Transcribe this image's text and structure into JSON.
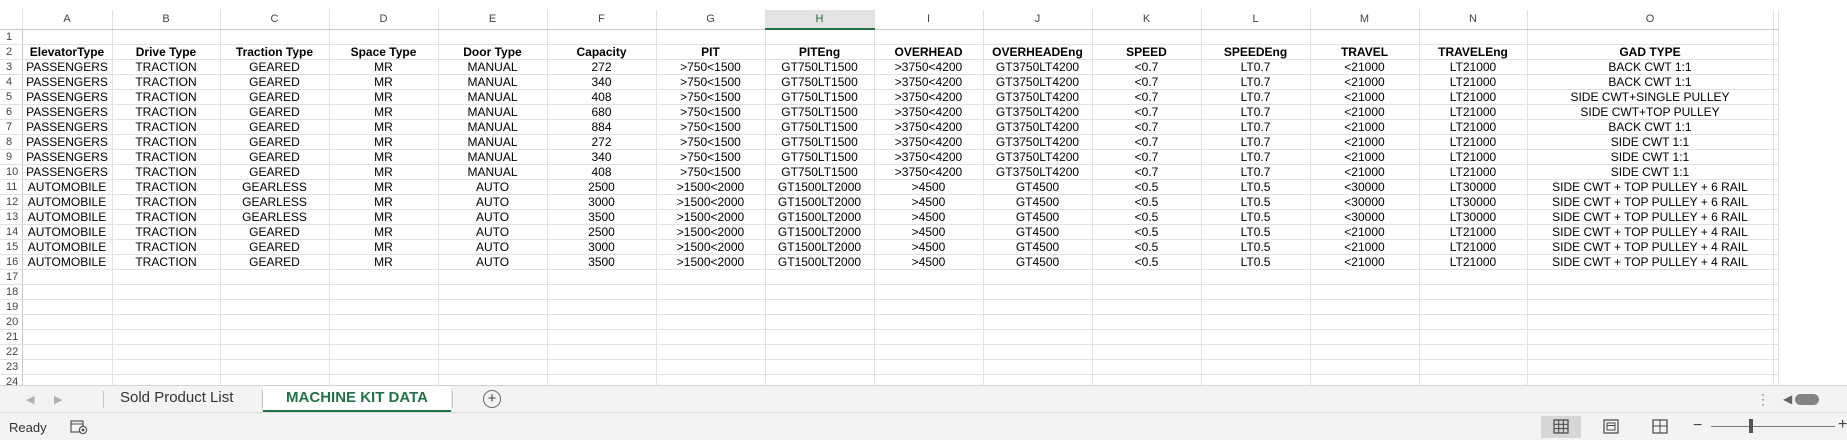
{
  "sheet": {
    "columns": [
      "A",
      "B",
      "C",
      "D",
      "E",
      "F",
      "G",
      "H",
      "I",
      "J",
      "K",
      "L",
      "M",
      "N",
      "O"
    ],
    "selected_column": "H",
    "visible_rows": [
      1,
      2,
      3,
      4,
      5,
      6,
      7,
      8,
      9,
      10,
      11,
      12,
      13,
      14,
      15,
      16,
      17,
      18,
      19,
      20,
      21,
      22,
      23,
      24
    ],
    "header_row_number": 2,
    "headers": [
      "ElevatorType",
      "Drive Type",
      "Traction Type",
      "Space Type",
      "Door Type",
      "Capacity",
      "PIT",
      "PITEng",
      "OVERHEAD",
      "OVERHEADEng",
      "SPEED",
      "SPEEDEng",
      "TRAVEL",
      "TRAVELEng",
      "GAD TYPE"
    ],
    "data_start_row": 3,
    "rows": [
      [
        "PASSENGERS",
        "TRACTION",
        "GEARED",
        "MR",
        "MANUAL",
        "272",
        ">750<1500",
        "GT750LT1500",
        ">3750<4200",
        "GT3750LT4200",
        "<0.7",
        "LT0.7",
        "<21000",
        "LT21000",
        "BACK CWT 1:1"
      ],
      [
        "PASSENGERS",
        "TRACTION",
        "GEARED",
        "MR",
        "MANUAL",
        "340",
        ">750<1500",
        "GT750LT1500",
        ">3750<4200",
        "GT3750LT4200",
        "<0.7",
        "LT0.7",
        "<21000",
        "LT21000",
        "BACK CWT 1:1"
      ],
      [
        "PASSENGERS",
        "TRACTION",
        "GEARED",
        "MR",
        "MANUAL",
        "408",
        ">750<1500",
        "GT750LT1500",
        ">3750<4200",
        "GT3750LT4200",
        "<0.7",
        "LT0.7",
        "<21000",
        "LT21000",
        "SIDE CWT+SINGLE PULLEY"
      ],
      [
        "PASSENGERS",
        "TRACTION",
        "GEARED",
        "MR",
        "MANUAL",
        "680",
        ">750<1500",
        "GT750LT1500",
        ">3750<4200",
        "GT3750LT4200",
        "<0.7",
        "LT0.7",
        "<21000",
        "LT21000",
        "SIDE CWT+TOP PULLEY"
      ],
      [
        "PASSENGERS",
        "TRACTION",
        "GEARED",
        "MR",
        "MANUAL",
        "884",
        ">750<1500",
        "GT750LT1500",
        ">3750<4200",
        "GT3750LT4200",
        "<0.7",
        "LT0.7",
        "<21000",
        "LT21000",
        "BACK CWT 1:1"
      ],
      [
        "PASSENGERS",
        "TRACTION",
        "GEARED",
        "MR",
        "MANUAL",
        "272",
        ">750<1500",
        "GT750LT1500",
        ">3750<4200",
        "GT3750LT4200",
        "<0.7",
        "LT0.7",
        "<21000",
        "LT21000",
        "SIDE CWT 1:1"
      ],
      [
        "PASSENGERS",
        "TRACTION",
        "GEARED",
        "MR",
        "MANUAL",
        "340",
        ">750<1500",
        "GT750LT1500",
        ">3750<4200",
        "GT3750LT4200",
        "<0.7",
        "LT0.7",
        "<21000",
        "LT21000",
        "SIDE CWT 1:1"
      ],
      [
        "PASSENGERS",
        "TRACTION",
        "GEARED",
        "MR",
        "MANUAL",
        "408",
        ">750<1500",
        "GT750LT1500",
        ">3750<4200",
        "GT3750LT4200",
        "<0.7",
        "LT0.7",
        "<21000",
        "LT21000",
        "SIDE CWT 1:1"
      ],
      [
        "AUTOMOBILE",
        "TRACTION",
        "GEARLESS",
        "MR",
        "AUTO",
        "2500",
        ">1500<2000",
        "GT1500LT2000",
        ">4500",
        "GT4500",
        "<0.5",
        "LT0.5",
        "<30000",
        "LT30000",
        "SIDE CWT + TOP PULLEY + 6 RAIL"
      ],
      [
        "AUTOMOBILE",
        "TRACTION",
        "GEARLESS",
        "MR",
        "AUTO",
        "3000",
        ">1500<2000",
        "GT1500LT2000",
        ">4500",
        "GT4500",
        "<0.5",
        "LT0.5",
        "<30000",
        "LT30000",
        "SIDE CWT + TOP PULLEY + 6 RAIL"
      ],
      [
        "AUTOMOBILE",
        "TRACTION",
        "GEARLESS",
        "MR",
        "AUTO",
        "3500",
        ">1500<2000",
        "GT1500LT2000",
        ">4500",
        "GT4500",
        "<0.5",
        "LT0.5",
        "<30000",
        "LT30000",
        "SIDE CWT + TOP PULLEY + 6 RAIL"
      ],
      [
        "AUTOMOBILE",
        "TRACTION",
        "GEARED",
        "MR",
        "AUTO",
        "2500",
        ">1500<2000",
        "GT1500LT2000",
        ">4500",
        "GT4500",
        "<0.5",
        "LT0.5",
        "<21000",
        "LT21000",
        "SIDE CWT + TOP PULLEY + 4 RAIL"
      ],
      [
        "AUTOMOBILE",
        "TRACTION",
        "GEARED",
        "MR",
        "AUTO",
        "3000",
        ">1500<2000",
        "GT1500LT2000",
        ">4500",
        "GT4500",
        "<0.5",
        "LT0.5",
        "<21000",
        "LT21000",
        "SIDE CWT + TOP PULLEY + 4 RAIL"
      ],
      [
        "AUTOMOBILE",
        "TRACTION",
        "GEARED",
        "MR",
        "AUTO",
        "3500",
        ">1500<2000",
        "GT1500LT2000",
        ">4500",
        "GT4500",
        "<0.5",
        "LT0.5",
        "<21000",
        "LT21000",
        "SIDE CWT + TOP PULLEY + 4 RAIL"
      ]
    ]
  },
  "tabs": {
    "items": [
      {
        "label": "Sold Product List",
        "active": false
      },
      {
        "label": "MACHINE KIT DATA",
        "active": true
      }
    ],
    "add_sheet_symbol": "+",
    "overflow_symbol": "⋮"
  },
  "status": {
    "ready_label": "Ready",
    "macro_icon": "macro-record-icon",
    "views": [
      "normal-view-icon",
      "page-layout-icon",
      "page-break-preview-icon"
    ],
    "zoom_minus_symbol": "−",
    "zoom_plus_symbol": "+"
  },
  "colors": {
    "accent": "#217346",
    "gridline": "#e1e1e1",
    "chrome": "#f3f3f3"
  }
}
